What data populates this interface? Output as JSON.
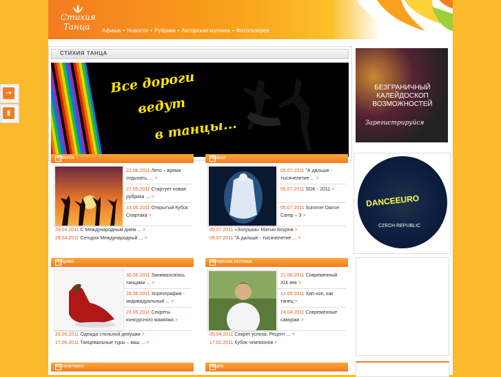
{
  "header": {
    "logo_line1": "Стихия",
    "logo_line2": "Танца",
    "nav": [
      "Афиша",
      "Новости",
      "Рубрики",
      "Авторская колонка",
      "Фотогалерея"
    ]
  },
  "section_title": "СТИХИЯ ТАНЦА",
  "banner": {
    "line1": "Все дороги",
    "line2": "ведут",
    "line3": "в танцы..."
  },
  "ads": {
    "ad1_text": "БЕЗГРАНИЧНЫЙ КАЛЕЙДОСКОП ВОЗМОЖНОСТЕЙ",
    "ad1_sub": "Зарегистрируйся",
    "ad2_text": "DANCEEURO",
    "ad2_sub": "CZECH REPUBLIC"
  },
  "panels": {
    "news": {
      "title": "Новости",
      "items": [
        {
          "date": "22.06.2011",
          "text": "Лето – время отдыхать, ..."
        },
        {
          "date": "27.05.2011",
          "text": "Стартует новая рубрика ..."
        },
        {
          "date": "23.05.2011",
          "text": "Открытый Кубок Спартака"
        }
      ],
      "footer": [
        {
          "date": "29.04.2011",
          "text": "С Международным днем ..."
        },
        {
          "date": "29.04.2011",
          "text": "Сегодня Международный ..."
        }
      ]
    },
    "afisha": {
      "title": "Афиша",
      "items": [
        {
          "date": "05.07.2011",
          "text": "\"А дальше - тысячелетие ..."
        },
        {
          "date": "05.07.2011",
          "text": "SDK - 2011"
        },
        {
          "date": "05.07.2011",
          "text": "Summer Dance Camp – 3"
        }
      ],
      "footer": [
        {
          "date": "05.07.2011",
          "text": "«Золушка» Матью Боурна"
        },
        {
          "date": "06.07.2011",
          "text": "\"А дальше - тысячелетие ..."
        }
      ]
    },
    "rubrics": {
      "title": "Рубрики",
      "items": [
        {
          "date": "30.06.2011",
          "text": "Занимался/ась танцами ..."
        },
        {
          "date": "28.06.2011",
          "text": "Хореография - индивидуальный ..."
        },
        {
          "date": "23.06.2011",
          "text": "Секреты конкурсного макияжа"
        }
      ],
      "footer": [
        {
          "date": "20.06.2011",
          "text": "Одежда стильной девушки"
        },
        {
          "date": "17.06.2011",
          "text": "Танцевальные туры – ваш ..."
        }
      ]
    },
    "author": {
      "title": "Авторская колонка",
      "items": [
        {
          "date": "21.06.2011",
          "text": "Современный XIX век"
        },
        {
          "date": "12.05.2011",
          "text": "Хип-хоп, как танец"
        },
        {
          "date": "24.04.2011",
          "text": "Современные самураи"
        }
      ],
      "footer": [
        {
          "date": "05.04.2011",
          "text": "Секрет успеха. Рецепт ..."
        },
        {
          "date": "17.02.2011",
          "text": "Кубок чемпионов"
        }
      ]
    },
    "photo": {
      "title": "Фотогалерея"
    },
    "video": {
      "title": "Видео"
    }
  },
  "colors": {
    "accent": "#f47b20",
    "date": "#e35a1e",
    "bg": "#fbb92c"
  }
}
